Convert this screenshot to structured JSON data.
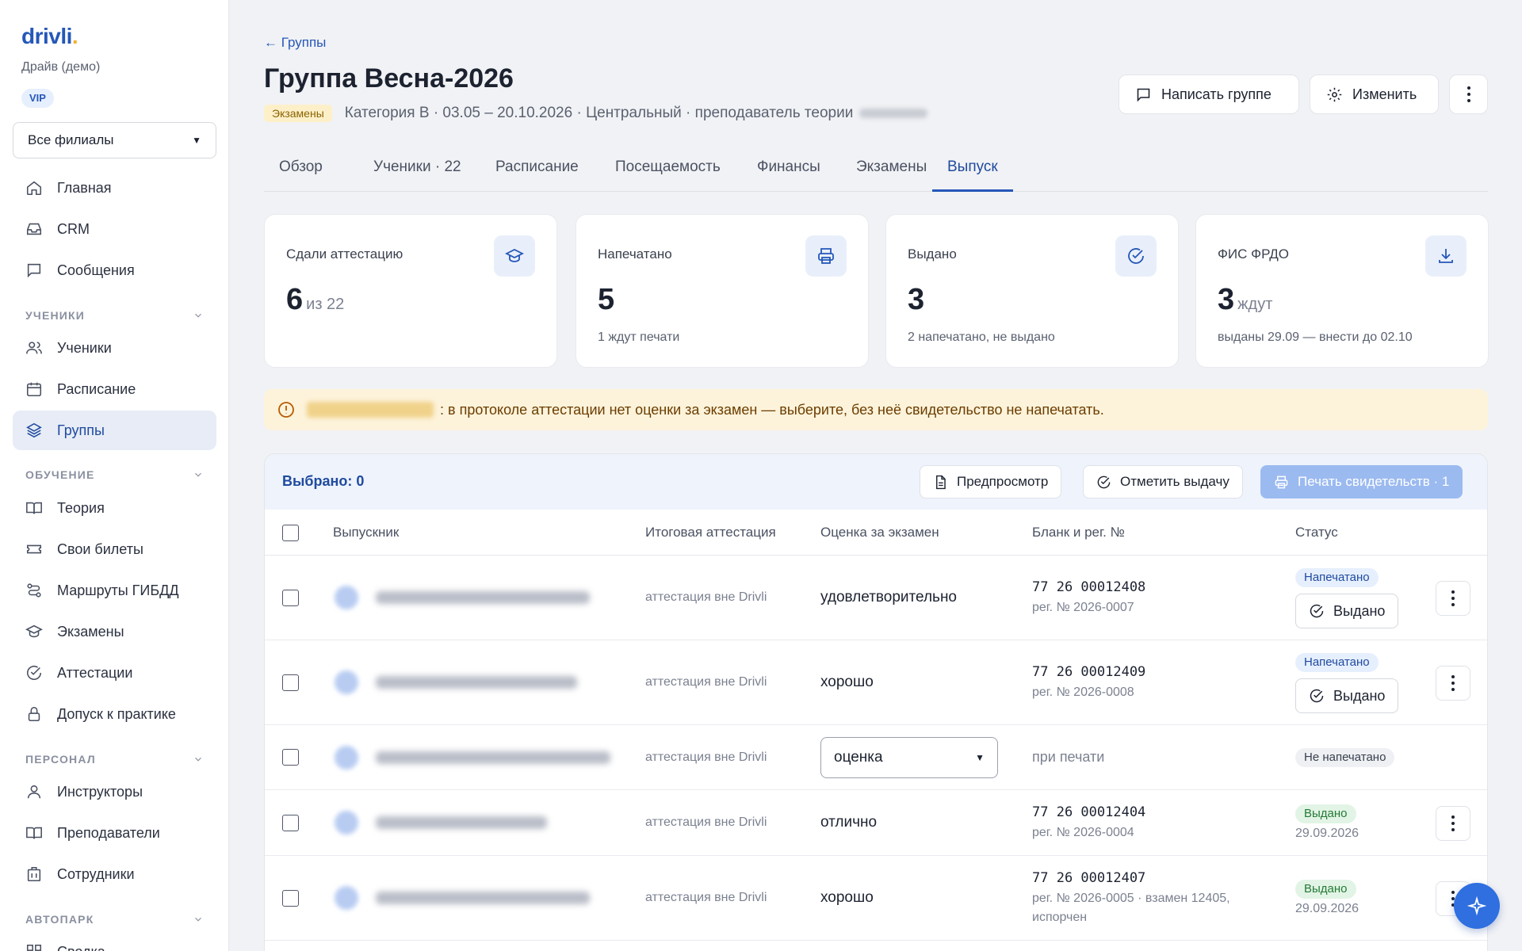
{
  "sidebar": {
    "logo": "drivli",
    "org_name": "Драйв (демо)",
    "plan_badge": "VIP",
    "branch_select": "Все филиалы",
    "items": [
      {
        "label": "Главная",
        "icon": "home-icon"
      },
      {
        "label": "CRM",
        "icon": "inbox-icon"
      },
      {
        "label": "Сообщения",
        "icon": "message-icon"
      },
      {
        "label": "Ученики",
        "icon": "users-icon"
      },
      {
        "label": "Расписание",
        "icon": "calendar-icon"
      },
      {
        "label": "Группы",
        "icon": "layers-icon"
      },
      {
        "label": "Теория",
        "icon": "book-icon"
      },
      {
        "label": "Свои билеты",
        "icon": "ticket-icon"
      },
      {
        "label": "Маршруты ГИБДД",
        "icon": "route-icon"
      },
      {
        "label": "Экзамены",
        "icon": "graduation-icon"
      },
      {
        "label": "Аттестации",
        "icon": "check-circle-icon"
      },
      {
        "label": "Допуск к практике",
        "icon": "lock-icon"
      },
      {
        "label": "Инструкторы",
        "icon": "user-icon"
      },
      {
        "label": "Преподаватели",
        "icon": "book-icon"
      },
      {
        "label": "Сотрудники",
        "icon": "building-icon"
      },
      {
        "label": "Сводка",
        "icon": "grid-icon"
      }
    ],
    "sections": {
      "students": "УЧЕНИКИ",
      "training": "ОБУЧЕНИЕ",
      "staff": "ПЕРСОНАЛ",
      "fleet": "АВТОПАРК"
    },
    "active_item": "Группы"
  },
  "header": {
    "back_label": "← Группы",
    "title": "Группа Весна-2026",
    "status_badge": "Экзамены",
    "meta": "Категория B · 03.05 – 20.10.2026 · Центральный · преподаватель теории",
    "message_button": "Написать группе",
    "edit_button": "Изменить"
  },
  "tabs": [
    "Обзор",
    "Ученики · 22",
    "Расписание",
    "Посещаемость",
    "Финансы",
    "Экзамены",
    "Выпуск"
  ],
  "active_tab": "Выпуск",
  "stats": [
    {
      "label": "Сдали аттестацию",
      "value": "6",
      "suffix": "из 22",
      "sub": "",
      "icon": "graduation-icon"
    },
    {
      "label": "Напечатано",
      "value": "5",
      "suffix": "",
      "sub": "1 ждут печати",
      "icon": "printer-icon"
    },
    {
      "label": "Выдано",
      "value": "3",
      "suffix": "",
      "sub": "2 напечатано, не выдано",
      "icon": "check-circle-icon"
    },
    {
      "label": "ФИС ФРДО",
      "value": "3",
      "suffix": "ждут",
      "sub": "выданы 29.09 — внести до 02.10",
      "icon": "download-icon"
    }
  ],
  "warning": {
    "text": ": в протоколе аттестации нет оценки за экзамен — выберите, без неё свидетельство не напечатать."
  },
  "toolbar": {
    "selected": "Выбрано: 0",
    "preview_button": "Предпросмотр",
    "mark_issued_button": "Отметить выдачу",
    "print_button": "Печать свидетельств · 1"
  },
  "table": {
    "columns": [
      "Выпускник",
      "Итоговая аттестация",
      "Оценка за экзамен",
      "Бланк и рег. №",
      "Статус"
    ],
    "rows": [
      {
        "attestation": "аттестация вне Drivli",
        "grade": "удовлетворительно",
        "blank": "77 26 00012408",
        "reg": "рег. № 2026-0007",
        "status": "Напечатано",
        "action": "Выдано",
        "date": ""
      },
      {
        "attestation": "аттестация вне Drivli",
        "grade": "хорошо",
        "blank": "77 26 00012409",
        "reg": "рег. № 2026-0008",
        "status": "Напечатано",
        "action": "Выдано",
        "date": ""
      },
      {
        "attestation": "аттестация вне Drivli",
        "grade_select": "оценка",
        "pending": "при печати",
        "status": "Не напечатано"
      },
      {
        "attestation": "аттестация вне Drivli",
        "grade": "отлично",
        "blank": "77 26 00012404",
        "reg": "рег. № 2026-0004",
        "status": "Выдано",
        "date": "29.09.2026"
      },
      {
        "attestation": "аттестация вне Drivli",
        "grade": "хорошо",
        "blank": "77 26 00012407",
        "reg": "рег. № 2026-0005 · взамен 12405, испорчен",
        "status": "Выдано",
        "date": "29.09.2026"
      }
    ]
  },
  "colors": {
    "accent": "#2557b8",
    "active_nav_bg": "#e7ecf6",
    "warning_bg": "#fdf3da",
    "printed_pill": "#e6effd",
    "issued_pill": "#e2f4e5"
  }
}
